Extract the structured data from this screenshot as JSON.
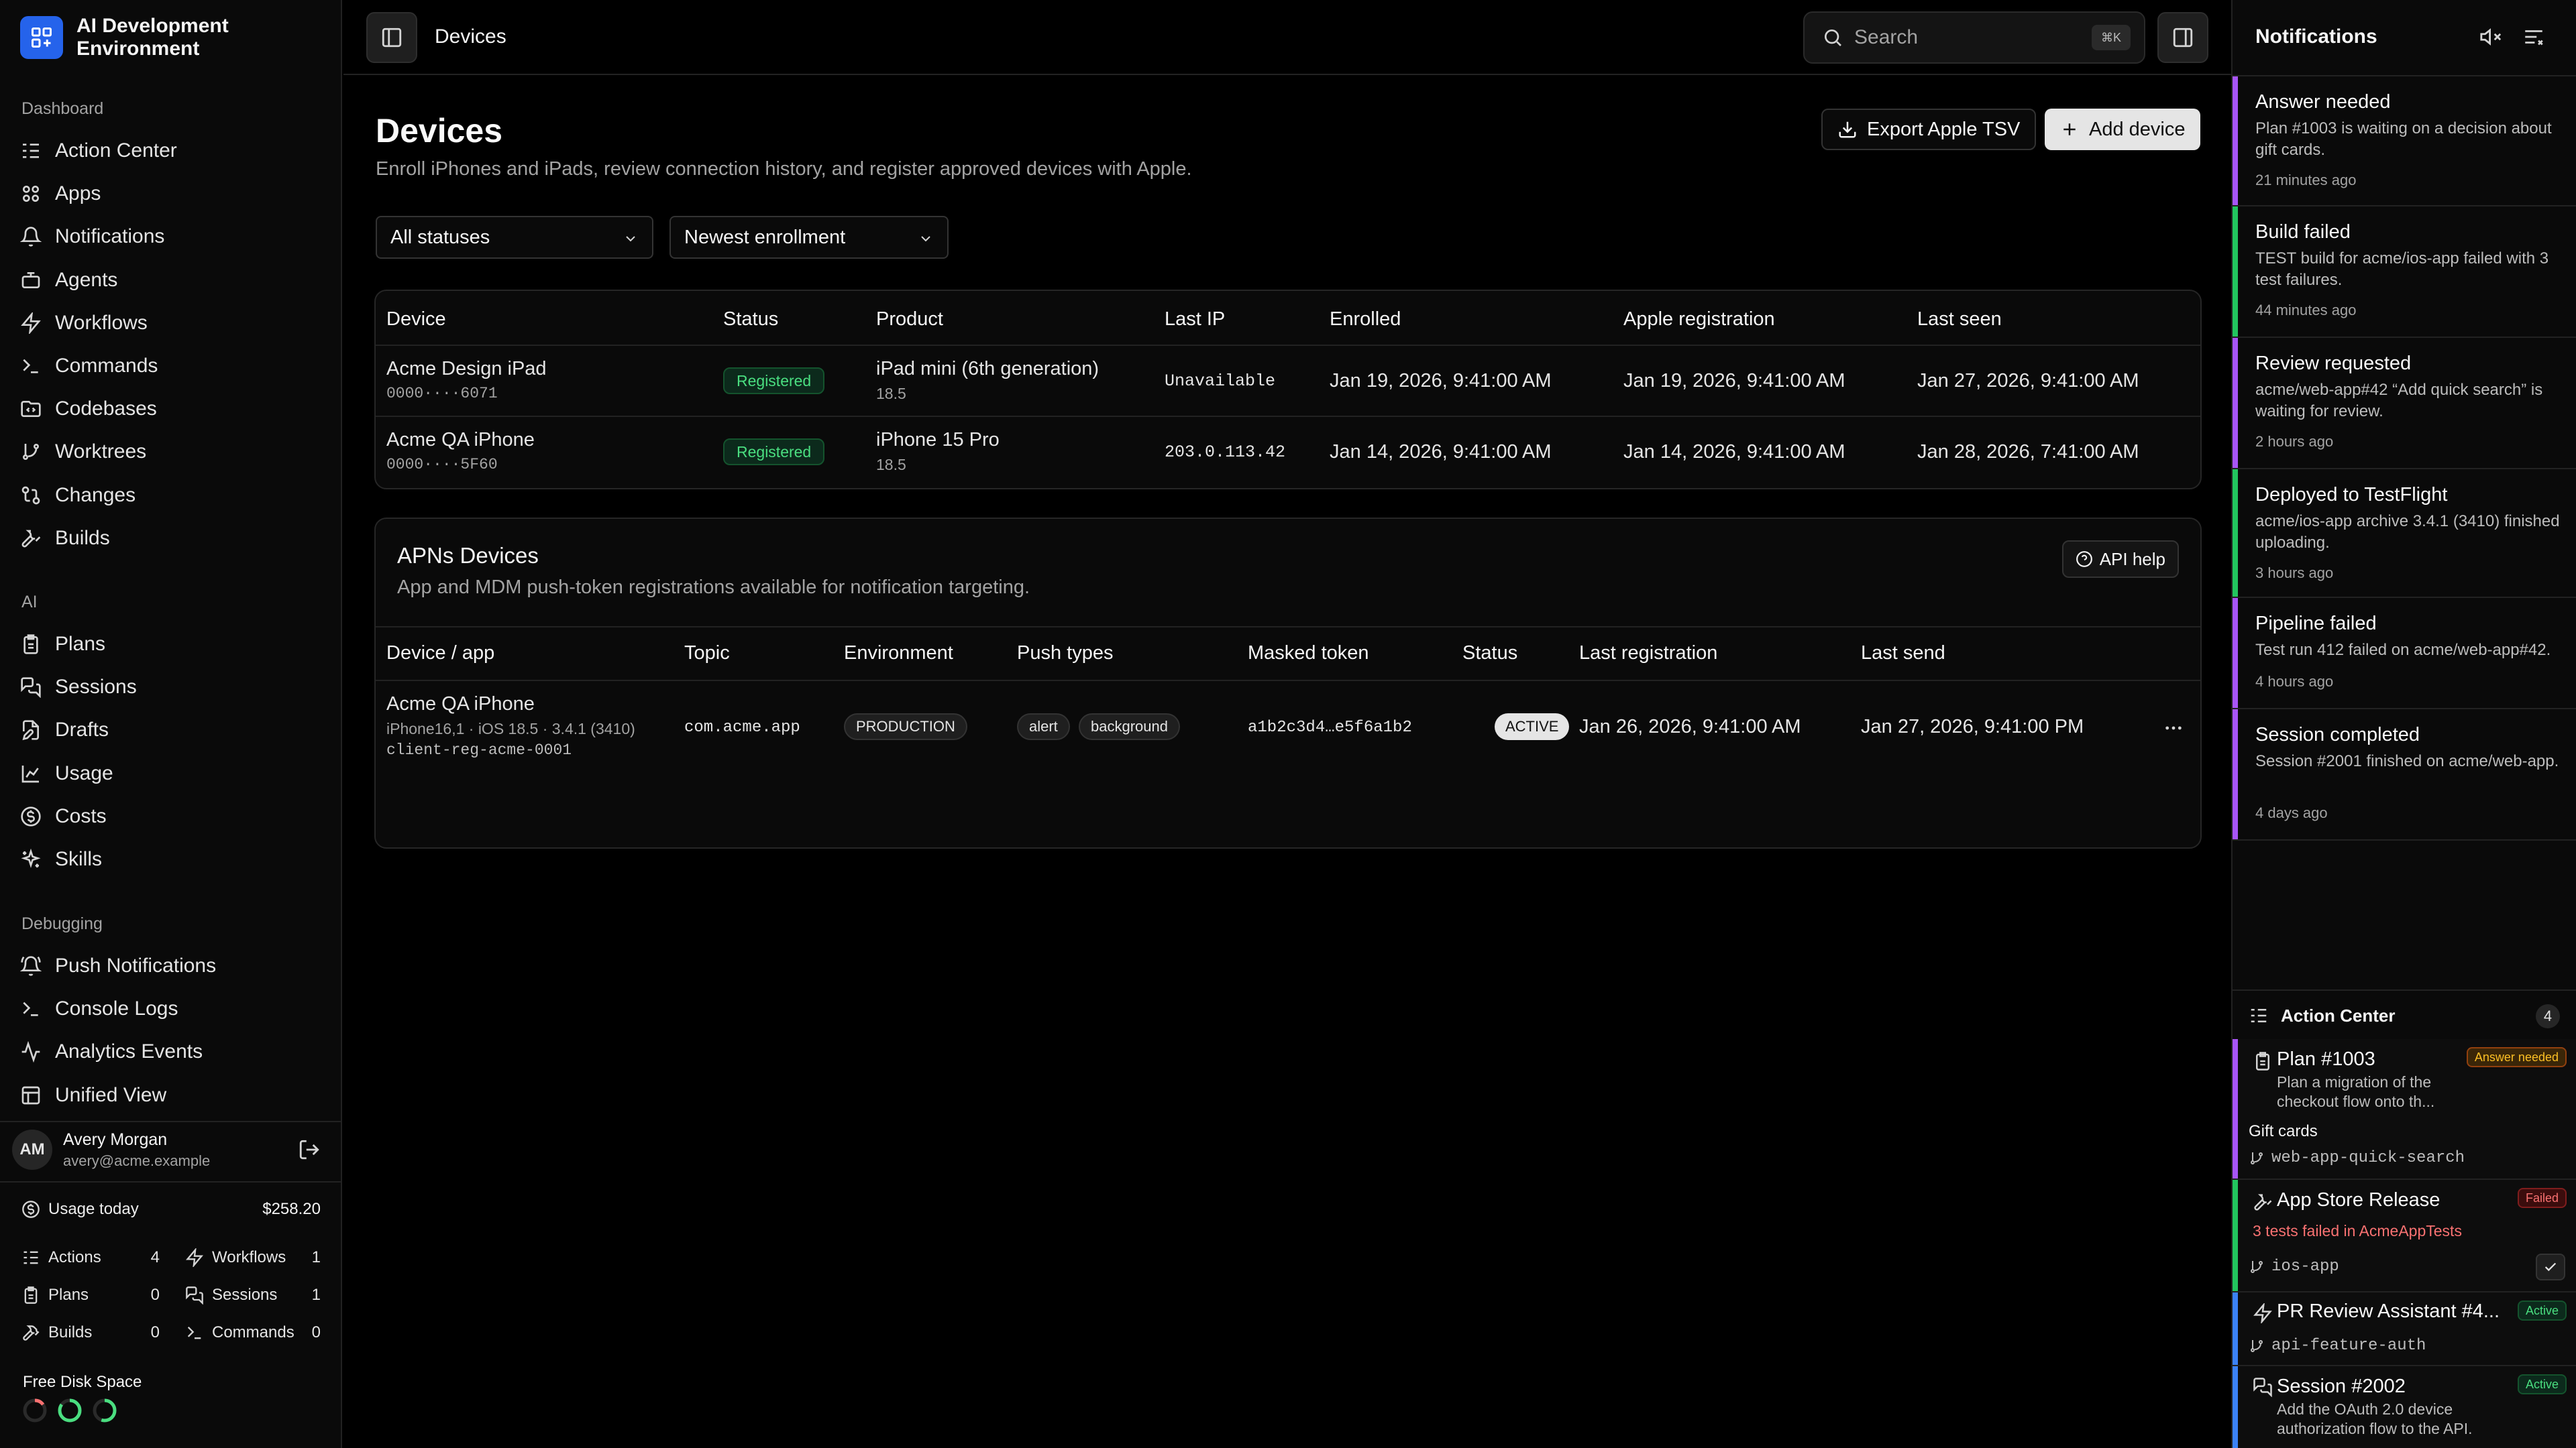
{
  "app": {
    "name": "AI Development Environment"
  },
  "sidebar": {
    "dashboard_label": "Dashboard",
    "dashboard_items": [
      {
        "label": "Action Center",
        "icon": "list-checks-icon"
      },
      {
        "label": "Apps",
        "icon": "apps-icon"
      },
      {
        "label": "Notifications",
        "icon": "bell-icon"
      },
      {
        "label": "Agents",
        "icon": "bot-icon"
      },
      {
        "label": "Workflows",
        "icon": "workflow-icon"
      },
      {
        "label": "Commands",
        "icon": "terminal-icon"
      },
      {
        "label": "Codebases",
        "icon": "folder-code-icon"
      },
      {
        "label": "Worktrees",
        "icon": "git-branch-icon"
      },
      {
        "label": "Changes",
        "icon": "git-compare-icon"
      },
      {
        "label": "Builds",
        "icon": "hammer-icon"
      }
    ],
    "ai_label": "AI",
    "ai_items": [
      {
        "label": "Plans",
        "icon": "clipboard-icon"
      },
      {
        "label": "Sessions",
        "icon": "messages-icon"
      },
      {
        "label": "Drafts",
        "icon": "file-edit-icon"
      },
      {
        "label": "Usage",
        "icon": "chart-icon"
      },
      {
        "label": "Costs",
        "icon": "dollar-icon"
      },
      {
        "label": "Skills",
        "icon": "sparkles-icon"
      }
    ],
    "debugging_label": "Debugging",
    "debugging_items": [
      {
        "label": "Push Notifications",
        "icon": "bell-ring-icon"
      },
      {
        "label": "Console Logs",
        "icon": "terminal-icon"
      },
      {
        "label": "Analytics Events",
        "icon": "activity-icon"
      },
      {
        "label": "Unified View",
        "icon": "layout-icon"
      }
    ],
    "user": {
      "initials": "AM",
      "name": "Avery Morgan",
      "email": "avery@acme.example"
    },
    "usage": {
      "label": "Usage today",
      "value": "$258.20"
    },
    "stats": {
      "actions": {
        "label": "Actions",
        "value": "4"
      },
      "workflows": {
        "label": "Workflows",
        "value": "1"
      },
      "plans": {
        "label": "Plans",
        "value": "0"
      },
      "sessions": {
        "label": "Sessions",
        "value": "1"
      },
      "builds": {
        "label": "Builds",
        "value": "0"
      },
      "commands": {
        "label": "Commands",
        "value": "0"
      }
    },
    "disk": {
      "label": "Free Disk Space",
      "rings": [
        {
          "color": "#f87171",
          "fraction": 0.15
        },
        {
          "color": "#4ade80",
          "fraction": 0.85
        },
        {
          "color": "#4ade80",
          "fraction": 0.55
        }
      ]
    }
  },
  "topbar": {
    "breadcrumb": "Devices",
    "search_placeholder": "Search",
    "search_shortcut": "⌘K"
  },
  "page": {
    "title": "Devices",
    "subtitle": "Enroll iPhones and iPads, review connection history, and register approved devices with Apple.",
    "export_label": "Export Apple TSV",
    "add_label": "Add device",
    "filter_status": "All statuses",
    "filter_sort": "Newest enrollment"
  },
  "devices_table": {
    "headers": [
      "Device",
      "Status",
      "Product",
      "Last IP",
      "Enrolled",
      "Apple registration",
      "Last seen"
    ],
    "rows": [
      {
        "name": "Acme Design iPad",
        "id": "0000····6071",
        "status": "Registered",
        "product": "iPad mini (6th generation)",
        "os": "18.5",
        "ip": "Unavailable",
        "enrolled": "Jan 19, 2026, 9:41:00 AM",
        "apple": "Jan 19, 2026, 9:41:00 AM",
        "seen": "Jan 27, 2026, 9:41:00 AM"
      },
      {
        "name": "Acme QA iPhone",
        "id": "0000····5F60",
        "status": "Registered",
        "product": "iPhone 15 Pro",
        "os": "18.5",
        "ip": "203.0.113.42",
        "enrolled": "Jan 14, 2026, 9:41:00 AM",
        "apple": "Jan 14, 2026, 9:41:00 AM",
        "seen": "Jan 28, 2026, 7:41:00 AM"
      }
    ]
  },
  "apns": {
    "title": "APNs Devices",
    "subtitle": "App and MDM push-token registrations available for notification targeting.",
    "help_label": "API help",
    "headers": [
      "Device / app",
      "Topic",
      "Environment",
      "Push types",
      "Masked token",
      "Status",
      "Last registration",
      "Last send"
    ],
    "rows": [
      {
        "device": "Acme QA iPhone",
        "detail": "iPhone16,1 · iOS 18.5 · 3.4.1 (3410)",
        "client": "client-reg-acme-0001",
        "topic": "com.acme.app",
        "environment": "PRODUCTION",
        "push_types": [
          "alert",
          "background"
        ],
        "token": "a1b2c3d4…e5f6a1b2",
        "status": "ACTIVE",
        "last_registration": "Jan 26, 2026, 9:41:00 AM",
        "last_send": "Jan 27, 2026, 9:41:00 PM"
      }
    ]
  },
  "notifications": {
    "title": "Notifications",
    "items": [
      {
        "title": "Answer needed",
        "body": "Plan #1003 is waiting on a decision about gift cards.",
        "time": "21 minutes ago",
        "color": "#a855f7"
      },
      {
        "title": "Build failed",
        "body": "TEST build for acme/ios-app failed with 3 test failures.",
        "time": "44 minutes ago",
        "color": "#22c55e"
      },
      {
        "title": "Review requested",
        "body": "acme/web-app#42 “Add quick search” is waiting for review.",
        "time": "2 hours ago",
        "color": "#a855f7"
      },
      {
        "title": "Deployed to TestFlight",
        "body": "acme/ios-app archive 3.4.1 (3410) finished uploading.",
        "time": "3 hours ago",
        "color": "#22c55e"
      },
      {
        "title": "Pipeline failed",
        "body": "Test run 412 failed on acme/web-app#42.",
        "time": "4 hours ago",
        "color": "#a855f7"
      },
      {
        "title": "Session completed",
        "body": "Session #2001 finished on acme/web-app.",
        "time": "4 days ago",
        "color": "#a855f7"
      }
    ]
  },
  "action_center": {
    "title": "Action Center",
    "count": "4",
    "items": [
      {
        "title": "Plan #1003",
        "tag": "Answer needed",
        "desc": "Plan a migration of the checkout flow onto th...",
        "extra": "Gift cards",
        "branch": "web-app-quick-search",
        "color": "#a855f7"
      },
      {
        "title": "App Store Release",
        "tag": "Failed",
        "desc": "3 tests failed in AcmeAppTests",
        "branch": "ios-app",
        "color": "#22c55e"
      },
      {
        "title": "PR Review Assistant #4...",
        "tag": "Active",
        "branch": "api-feature-auth",
        "color": "#3b82f6"
      },
      {
        "title": "Session #2002",
        "tag": "Active",
        "desc": "Add the OAuth 2.0 device authorization flow to the API.",
        "color": "#3b82f6"
      }
    ]
  }
}
